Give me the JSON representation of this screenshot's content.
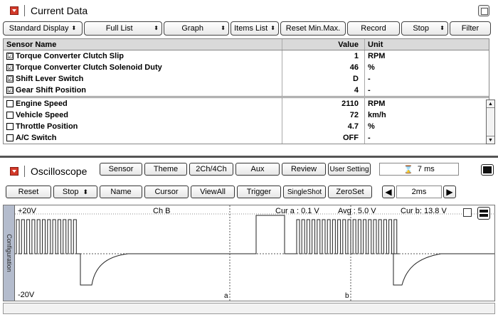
{
  "current_data": {
    "title": "Current Data",
    "toolbar": [
      {
        "label": "Standard Display",
        "spin": true
      },
      {
        "label": "Full List",
        "spin": true
      },
      {
        "label": "Graph",
        "spin": true
      },
      {
        "label": "Items List",
        "spin": true
      },
      {
        "label": "Reset Min.Max.",
        "spin": false
      },
      {
        "label": "Record",
        "spin": false
      },
      {
        "label": "Stop",
        "spin": true
      },
      {
        "label": "Filter",
        "spin": false
      }
    ],
    "headers": {
      "name": "Sensor Name",
      "value": "Value",
      "unit": "Unit"
    },
    "selected_rows": [
      {
        "name": "Torque Converter Clutch Slip",
        "value": "1",
        "unit": "RPM",
        "checked": "☑"
      },
      {
        "name": "Torque Converter Clutch Solenoid Duty",
        "value": "46",
        "unit": "%",
        "checked": "☑"
      },
      {
        "name": "Shift Lever Switch",
        "value": "D",
        "unit": "-",
        "checked": "☑"
      },
      {
        "name": "Gear Shift Position",
        "value": "4",
        "unit": "-",
        "checked": "☑"
      }
    ],
    "other_rows": [
      {
        "name": "Engine Speed",
        "value": "2110",
        "unit": "RPM",
        "checked": ""
      },
      {
        "name": "Vehicle Speed",
        "value": "72",
        "unit": "km/h",
        "checked": ""
      },
      {
        "name": "Throttle Position",
        "value": "4.7",
        "unit": "%",
        "checked": ""
      },
      {
        "name": "A/C Switch",
        "value": "OFF",
        "unit": "-",
        "checked": ""
      }
    ],
    "scroll_up": "▲",
    "scroll_down": "▼"
  },
  "oscilloscope": {
    "title": "Oscilloscope",
    "top_buttons": [
      "Sensor",
      "Theme",
      "2Ch/4Ch",
      "Aux",
      "Review",
      "User Setting"
    ],
    "time_display": "7 ms",
    "controls": [
      "Reset",
      "Stop",
      "Name",
      "Cursor",
      "ViewAll",
      "Trigger",
      "SingleShot",
      "ZeroSet"
    ],
    "stop_spin": "⬍",
    "timebase": "2ms",
    "prev_icon": "◀",
    "next_icon": "▶",
    "config_tab": "Configuration",
    "scope": {
      "top_label": "+20V",
      "bottom_label": "-20V",
      "channel": "Ch B",
      "cursor_a": "Cur a : 0.1 V",
      "average": "Avg : 5.0 V",
      "cursor_b": "Cur b: 13.8 V",
      "marker_a": "a",
      "marker_b": "b"
    }
  },
  "colors": {
    "accent_red": "#d23a2a",
    "config_tab": "#b4bccd"
  }
}
